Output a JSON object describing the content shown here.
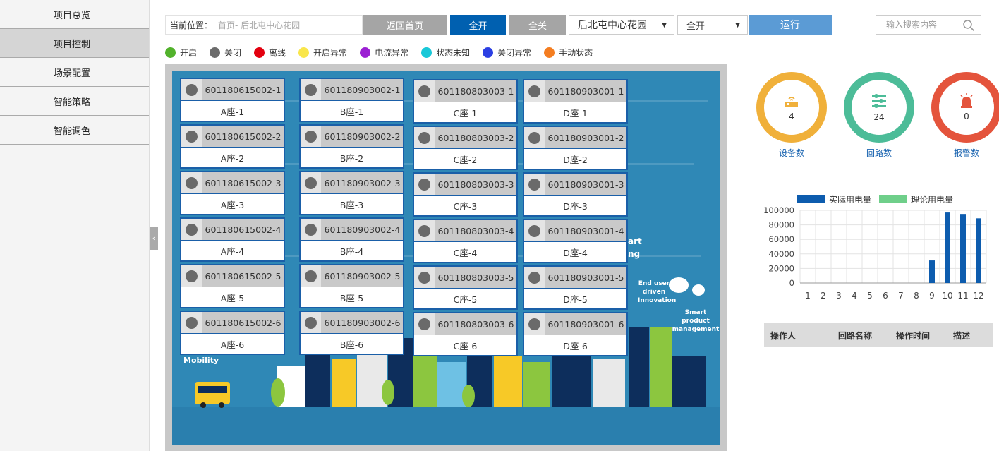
{
  "sidebar": {
    "items": [
      {
        "label": "项目总览"
      },
      {
        "label": "项目控制"
      },
      {
        "label": "场景配置"
      },
      {
        "label": "智能策略"
      },
      {
        "label": "智能调色"
      }
    ],
    "active_index": 1
  },
  "toolbar": {
    "location_label": "当前位置：",
    "breadcrumb": "首页- 后北屯中心花园",
    "home_label": "返回首页",
    "all_on_label": "全开",
    "all_off_label": "全关",
    "project_select": "后北屯中心花园",
    "mode_select": "全开",
    "run_label": "运行",
    "search_placeholder": "输入搜索内容"
  },
  "legend": [
    {
      "label": "开启",
      "color": "#52b22c"
    },
    {
      "label": "关闭",
      "color": "#6b6b6b"
    },
    {
      "label": "离线",
      "color": "#e3000f"
    },
    {
      "label": "开启异常",
      "color": "#f9e64b"
    },
    {
      "label": "电流异常",
      "color": "#9b1fd3"
    },
    {
      "label": "状态未知",
      "color": "#19c8d8"
    },
    {
      "label": "关闭异常",
      "color": "#2b3fe3"
    },
    {
      "label": "手动状态",
      "color": "#f47d20"
    }
  ],
  "devices": {
    "A": [
      {
        "code": "601180615002-1",
        "name": "A座-1"
      },
      {
        "code": "601180615002-2",
        "name": "A座-2"
      },
      {
        "code": "601180615002-3",
        "name": "A座-3"
      },
      {
        "code": "601180615002-4",
        "name": "A座-4"
      },
      {
        "code": "601180615002-5",
        "name": "A座-5"
      },
      {
        "code": "601180615002-6",
        "name": "A座-6"
      }
    ],
    "B": [
      {
        "code": "601180903002-1",
        "name": "B座-1"
      },
      {
        "code": "601180903002-2",
        "name": "B座-2"
      },
      {
        "code": "601180903002-3",
        "name": "B座-3"
      },
      {
        "code": "601180903002-4",
        "name": "B座-4"
      },
      {
        "code": "601180903002-5",
        "name": "B座-5"
      },
      {
        "code": "601180903002-6",
        "name": "B座-6"
      }
    ],
    "C": [
      {
        "code": "601180803003-1",
        "name": "C座-1"
      },
      {
        "code": "601180803003-2",
        "name": "C座-2"
      },
      {
        "code": "601180803003-3",
        "name": "C座-3"
      },
      {
        "code": "601180803003-4",
        "name": "C座-4"
      },
      {
        "code": "601180803003-5",
        "name": "C座-5"
      },
      {
        "code": "601180803003-6",
        "name": "C座-6"
      }
    ],
    "D": [
      {
        "code": "601180903001-1",
        "name": "D座-1"
      },
      {
        "code": "601180903001-2",
        "name": "D座-2"
      },
      {
        "code": "601180903001-3",
        "name": "D座-3"
      },
      {
        "code": "601180903001-4",
        "name": "D座-4"
      },
      {
        "code": "601180903001-5",
        "name": "D座-5"
      },
      {
        "code": "601180903001-6",
        "name": "D座-6"
      }
    ]
  },
  "map_text": {
    "mobility": "Mobility",
    "innovation": "End user driven Innovation",
    "product": "Smart product management",
    "smart": "art",
    "ng": "ng"
  },
  "stats": [
    {
      "value": "4",
      "label": "设备数",
      "color": "#f0b03a",
      "icon": "router-icon"
    },
    {
      "value": "24",
      "label": "回路数",
      "color": "#4cbc98",
      "icon": "sliders-icon"
    },
    {
      "value": "0",
      "label": "报警数",
      "color": "#e4543c",
      "icon": "alarm-icon"
    }
  ],
  "chart_data": {
    "type": "bar",
    "categories": [
      "1",
      "2",
      "3",
      "4",
      "5",
      "6",
      "7",
      "8",
      "9",
      "10",
      "11",
      "12"
    ],
    "series": [
      {
        "name": "实际用电量",
        "color": "#0d5cae",
        "values": [
          0,
          0,
          0,
          0,
          0,
          0,
          0,
          0,
          31000,
          97000,
          95000,
          89000
        ]
      },
      {
        "name": "理论用电量",
        "color": "#6fcf8a",
        "values": [
          0,
          0,
          0,
          0,
          0,
          0,
          0,
          0,
          0,
          0,
          0,
          0
        ]
      }
    ],
    "yticks": [
      "0",
      "20000",
      "40000",
      "60000",
      "80000",
      "100000"
    ],
    "ylim": [
      0,
      100000
    ],
    "grid": true,
    "legend": "top"
  },
  "log_table": {
    "headers": [
      "操作人",
      "回路名称",
      "操作时间",
      "描述"
    ]
  }
}
